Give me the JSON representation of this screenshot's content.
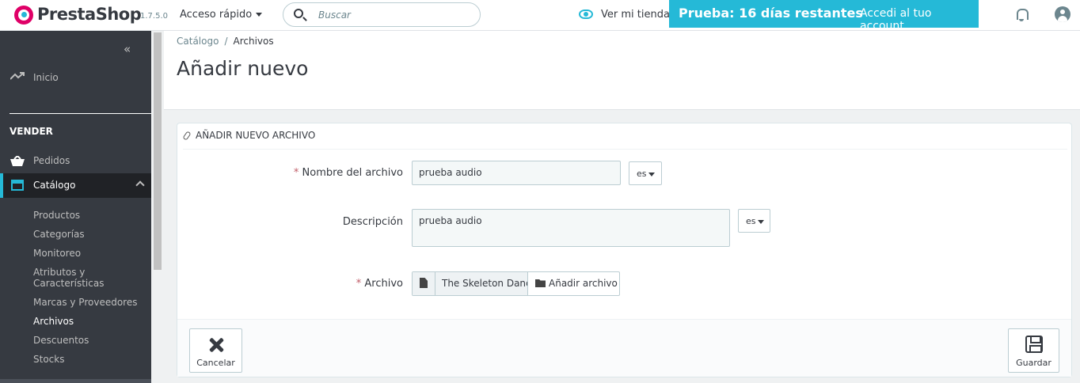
{
  "topbar": {
    "brand": "PrestaShop",
    "version": "1.7.5.0",
    "quick_access": "Acceso rápido",
    "search_placeholder": "Buscar",
    "view_shop": "Ver mi tienda",
    "trial_text": "Prueba: 16 días restantes",
    "account_link": "Accedi al tuo account"
  },
  "sidebar": {
    "home": "Inicio",
    "section": "VENDER",
    "orders": "Pedidos",
    "catalog": "Catálogo",
    "submenu": [
      "Productos",
      "Categorías",
      "Monitoreo",
      "Atributos y Características",
      "Marcas y Proveedores",
      "Archivos",
      "Descuentos",
      "Stocks"
    ],
    "active_submenu": "Archivos"
  },
  "header": {
    "breadcrumb": [
      "Catálogo",
      "Archivos"
    ],
    "title": "Añadir nuevo"
  },
  "form": {
    "panel_title": "AÑADIR NUEVO ARCHIVO",
    "name_label": "Nombre del archivo",
    "name_value": "prueba audio",
    "description_label": "Descripción",
    "description_value": "prueba audio",
    "file_label": "Archivo",
    "file_name": "The Skeleton Dance",
    "add_file": "Añadir archivo",
    "lang": "es",
    "required_mark": "*",
    "cancel": "Cancelar",
    "save": "Guardar"
  },
  "colors": {
    "accent": "#25b9d7",
    "sidebar": "#363a41",
    "required": "#c05c67"
  }
}
